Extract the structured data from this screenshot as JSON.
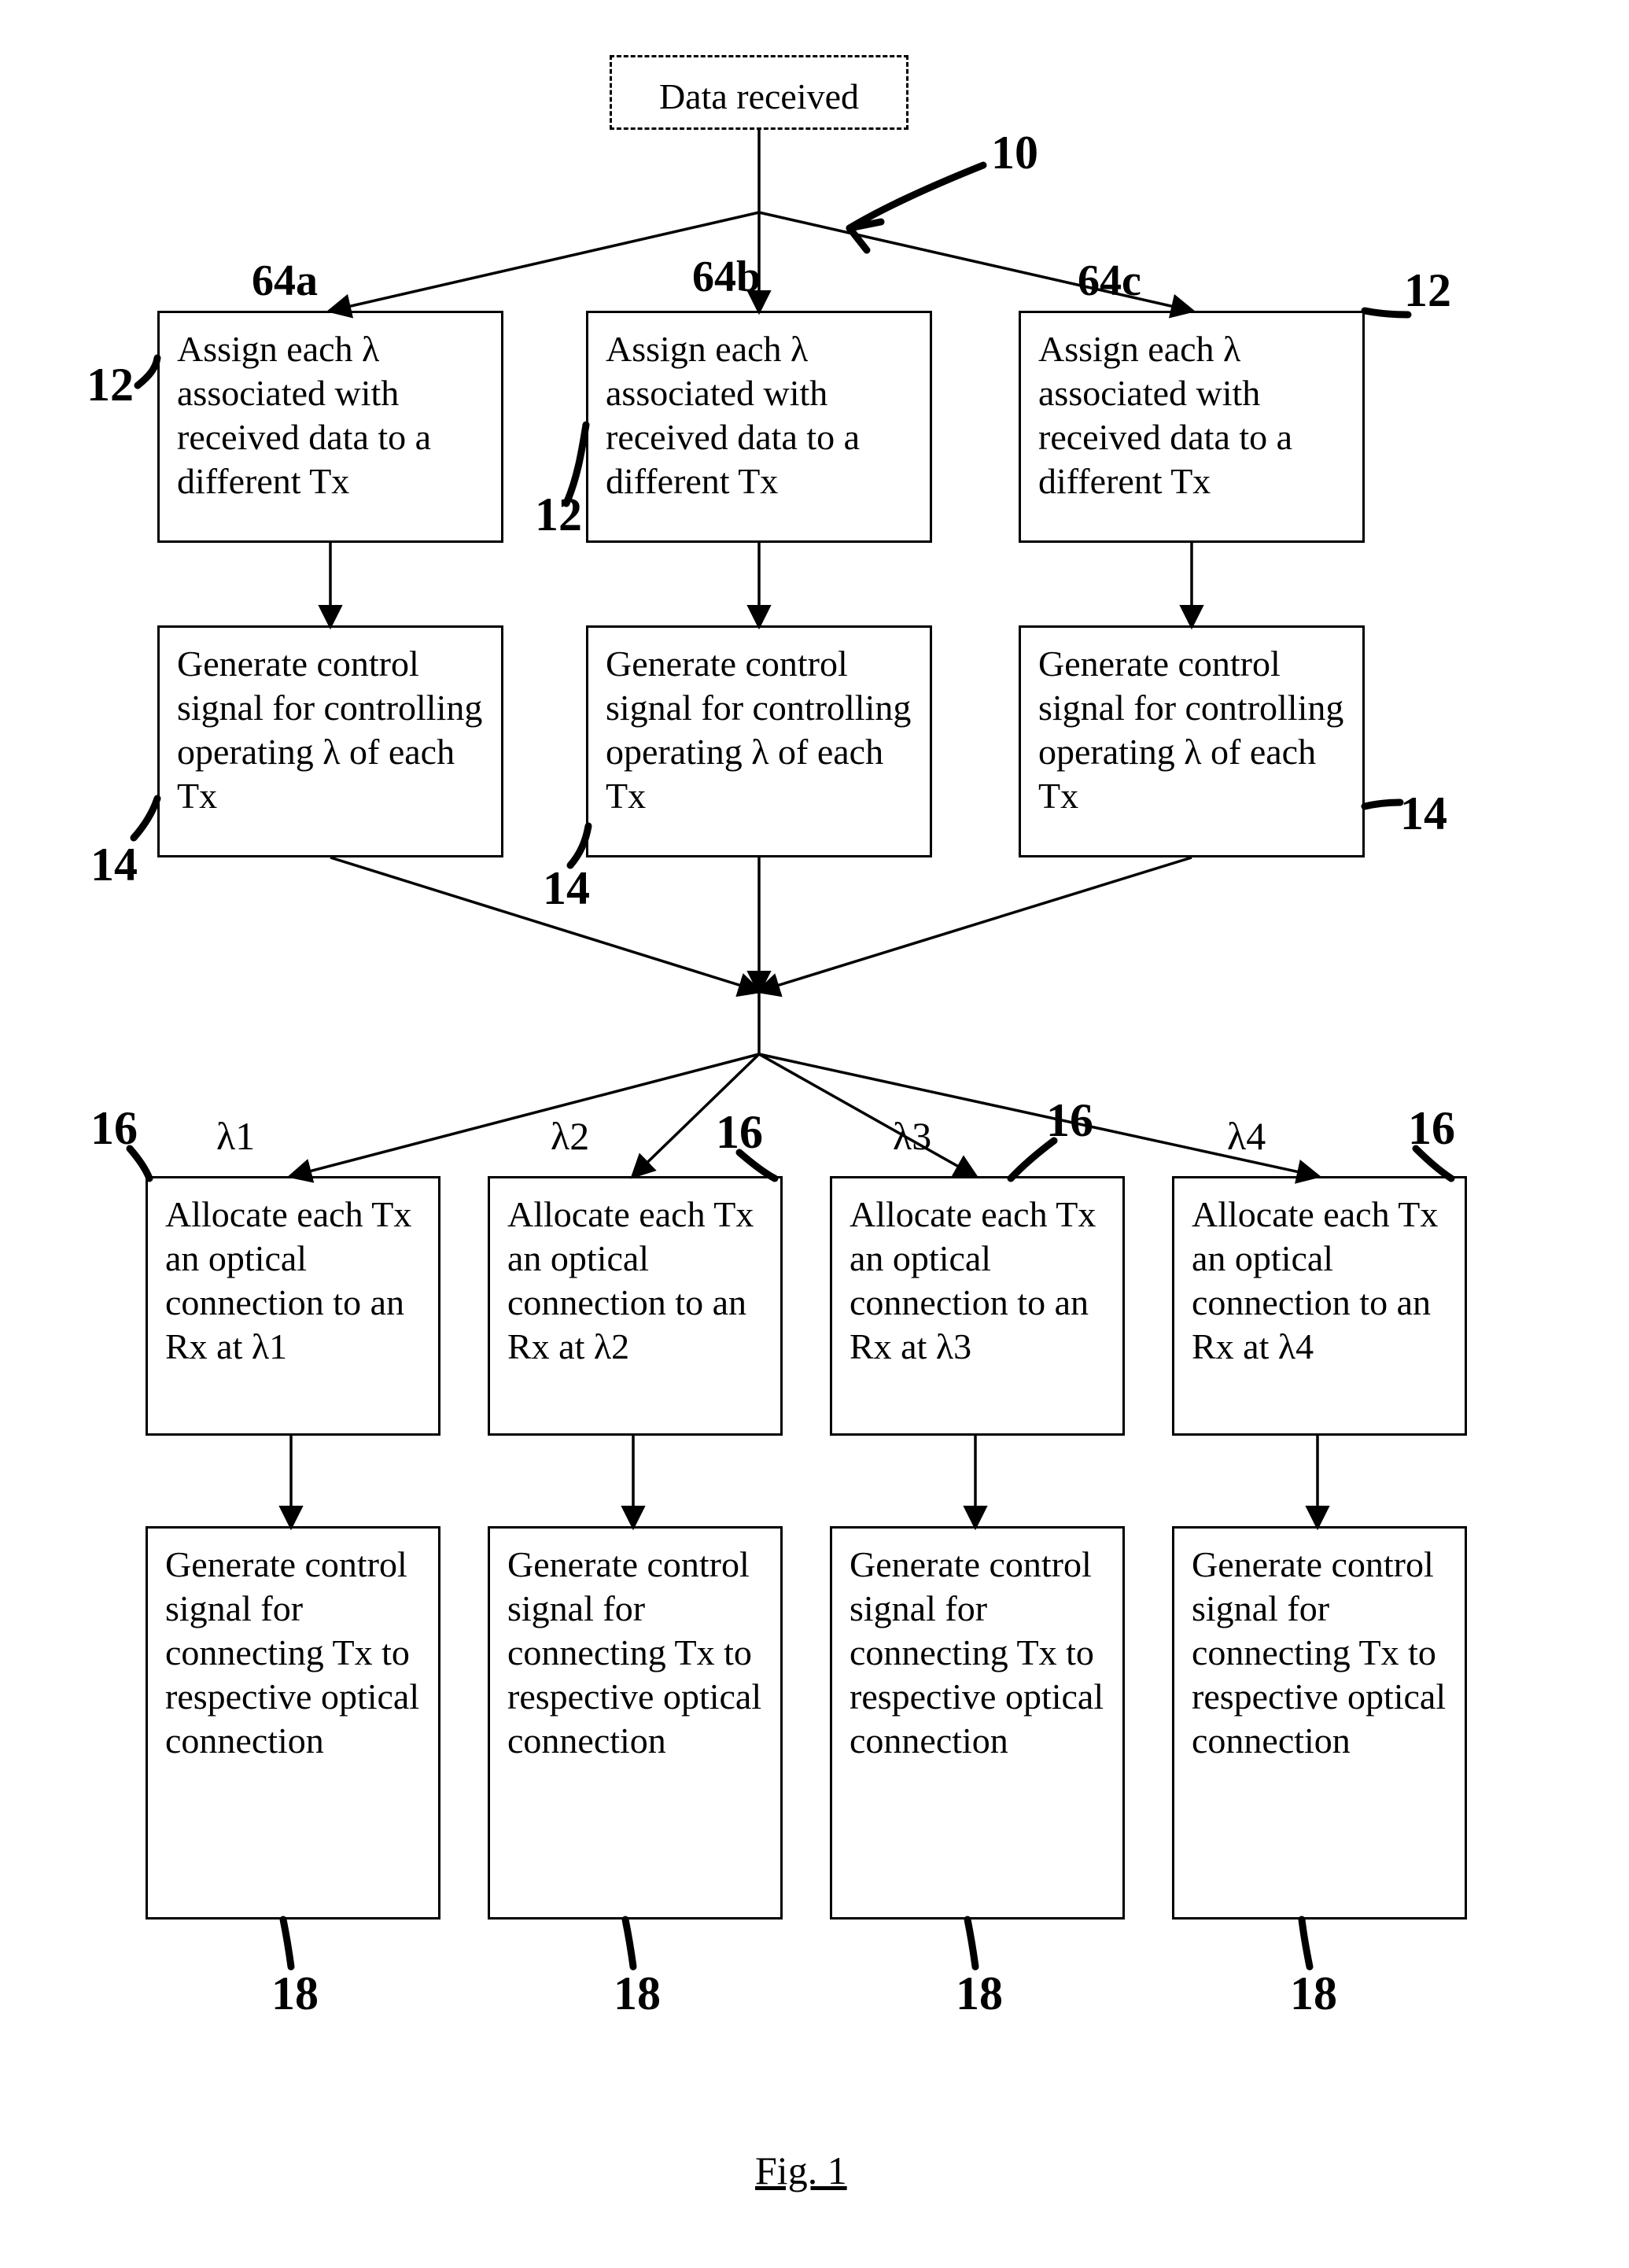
{
  "start": {
    "label": "Data received"
  },
  "row1": {
    "hand_labels": [
      "64a",
      "64b",
      "64c"
    ],
    "ref": "12",
    "texts": [
      "Assign each λ associated with received data to a different Tx",
      "Assign each λ associated with received data to a different Tx",
      "Assign each λ associated with received data to a different Tx"
    ]
  },
  "row2": {
    "ref": "14",
    "texts": [
      "Generate control signal for controlling operating λ of each Tx",
      "Generate control signal for controlling operating λ of each Tx",
      "Generate control signal for controlling operating λ of each Tx"
    ]
  },
  "middle_labels": [
    "λ1",
    "λ2",
    "λ3",
    "λ4"
  ],
  "row3": {
    "ref": "16",
    "texts": [
      "Allocate each Tx an optical connection to an Rx at λ1",
      "Allocate each Tx an optical connection to an Rx at λ2",
      "Allocate each Tx an optical connection to an Rx at λ3",
      "Allocate each Tx an optical connection to an Rx at λ4"
    ]
  },
  "row4": {
    "ref": "18",
    "texts": [
      "Generate control signal for connecting Tx to respective optical connection",
      "Generate control signal for connecting Tx to respective optical connection",
      "Generate control signal for connecting Tx to respective optical connection",
      "Generate control signal for connecting Tx to respective optical connection"
    ]
  },
  "figure_label": "Fig. 1",
  "overall_ref": "10"
}
